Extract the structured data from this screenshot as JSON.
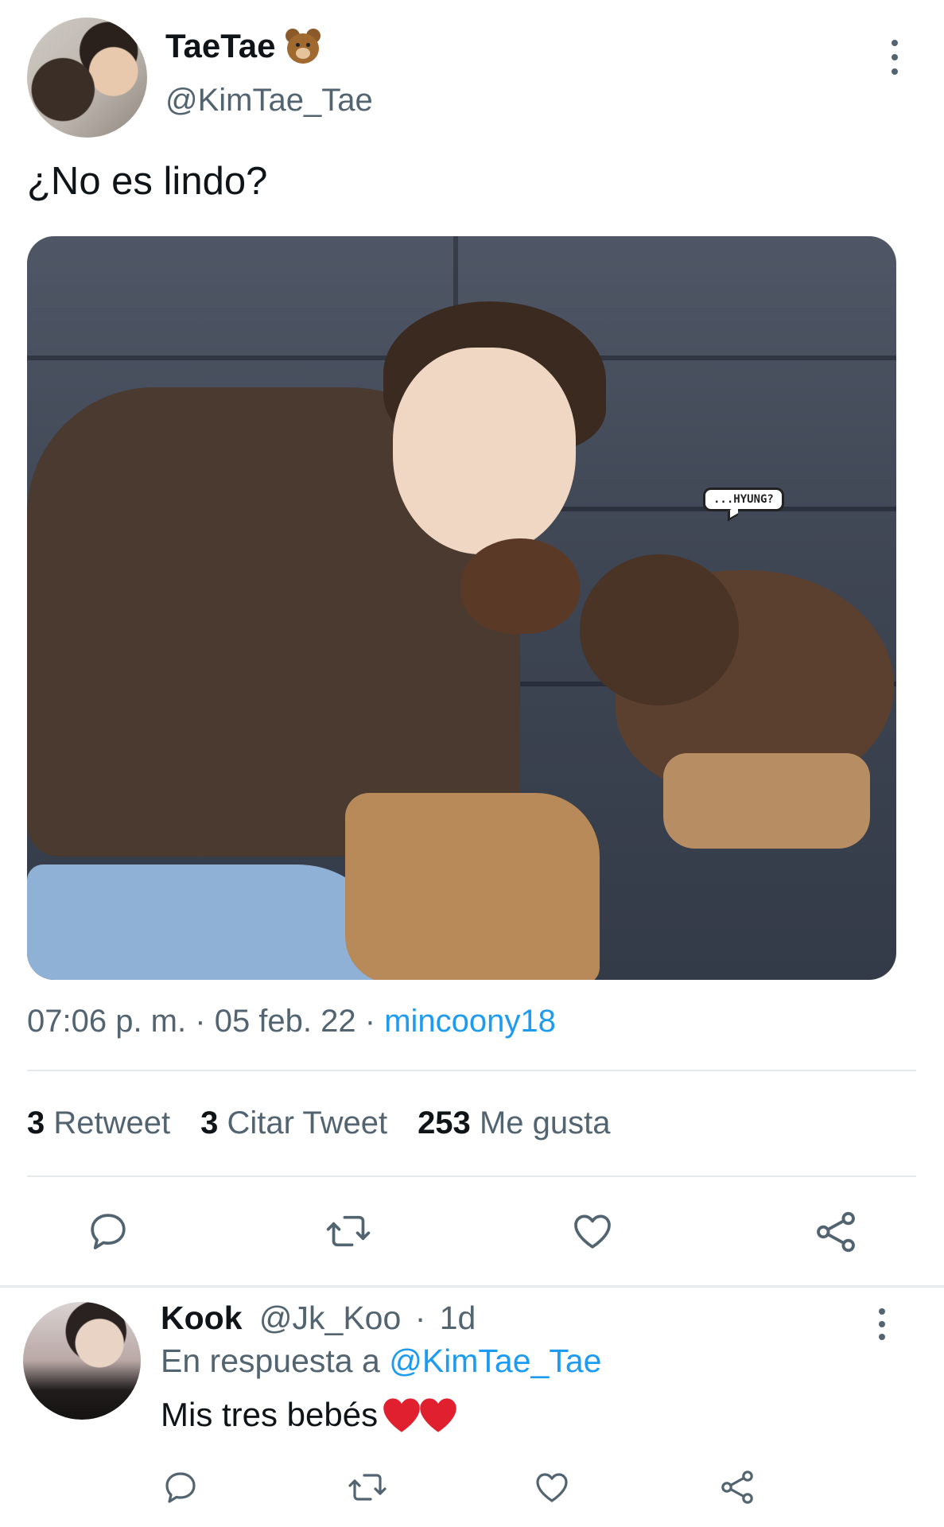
{
  "tweet": {
    "display_name": "TaeTae",
    "name_emoji": "bear-face-emoji",
    "username": "@KimTae_Tae",
    "text": "¿No es lindo?",
    "media_caption": "...HYUNG?",
    "time": "07:06 p. m.",
    "separator": "·",
    "date": "05 feb. 22",
    "source": "mincoony18"
  },
  "stats": {
    "retweets_count": "3",
    "retweets_label": "Retweet",
    "quotes_count": "3",
    "quotes_label": "Citar Tweet",
    "likes_count": "253",
    "likes_label": "Me gusta"
  },
  "actions": [
    "reply-icon",
    "retweet-icon",
    "like-icon",
    "share-icon"
  ],
  "reply": {
    "display_name": "Kook",
    "username": "@Jk_Koo",
    "separator": "·",
    "age": "1d",
    "in_reply_prefix": "En respuesta a",
    "in_reply_mention": "@KimTae_Tae",
    "text": "Mis tres bebés",
    "emoji": "red-heart-emoji x2"
  },
  "colors": {
    "text_primary": "#0f1419",
    "text_secondary": "#536471",
    "link": "#1d9bf0",
    "divider": "#e6e9eb"
  }
}
